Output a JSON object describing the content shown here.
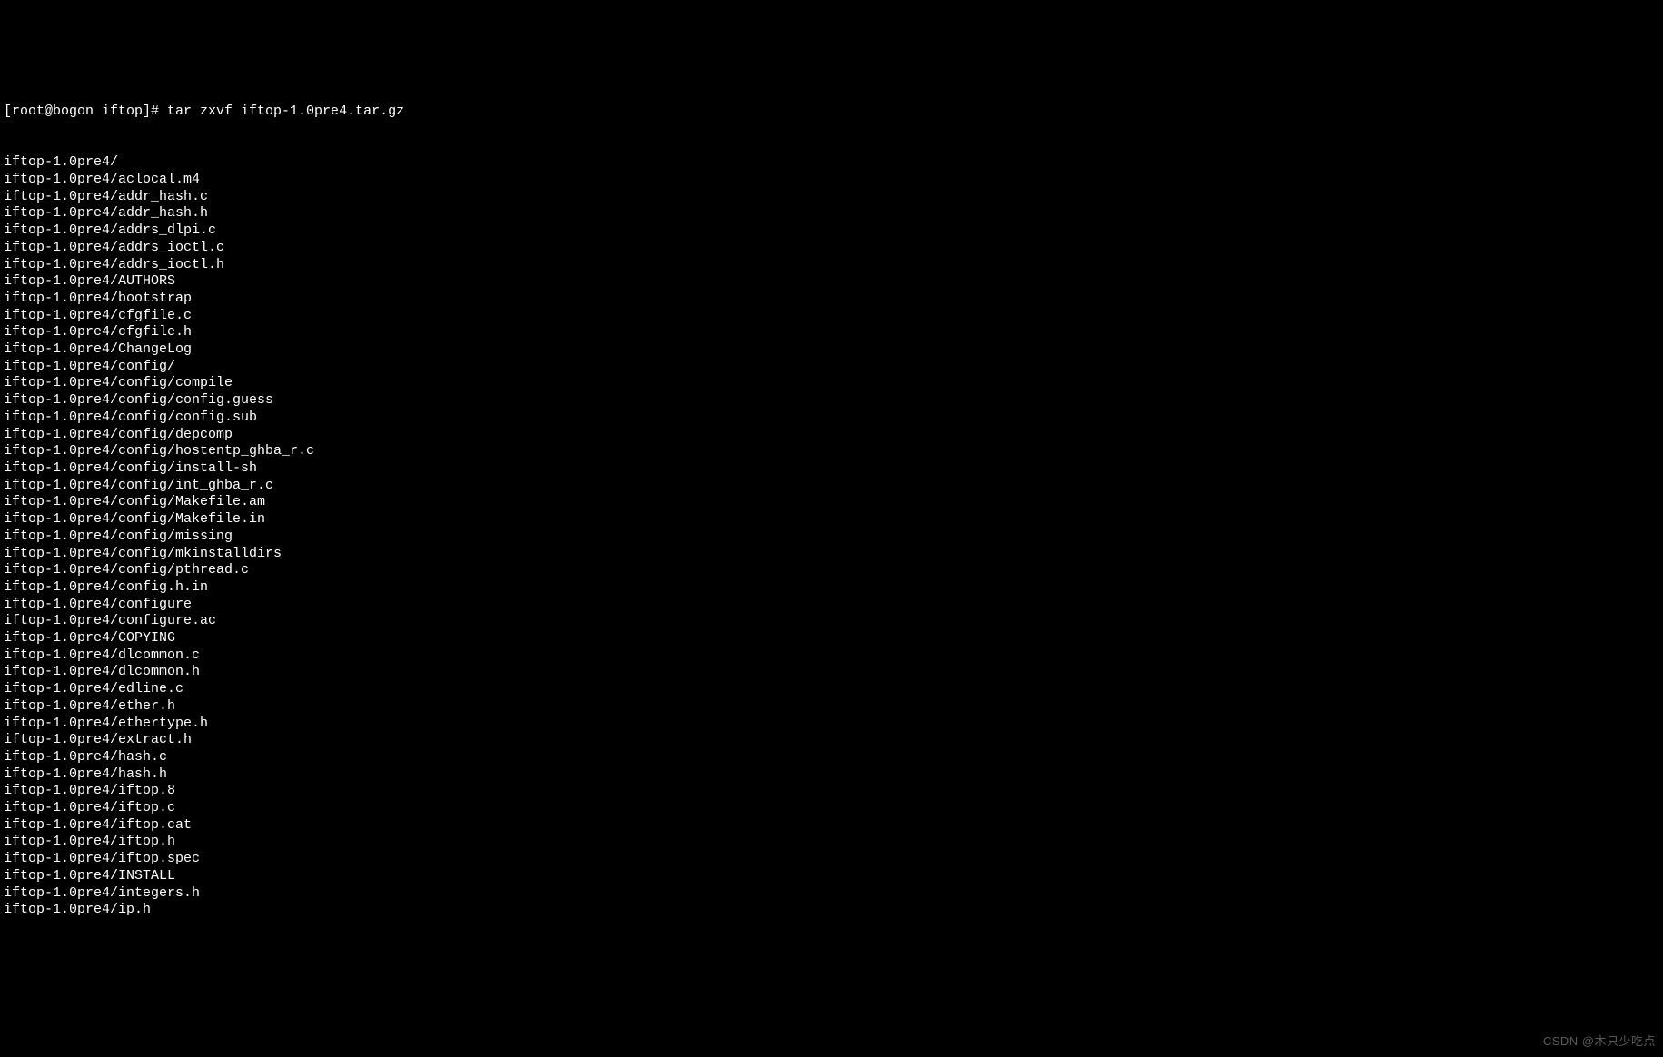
{
  "prompt": {
    "user_host": "[root@bogon iftop]#",
    "command": " tar zxvf iftop-1.0pre4.tar.gz"
  },
  "output_lines": [
    "iftop-1.0pre4/",
    "iftop-1.0pre4/aclocal.m4",
    "iftop-1.0pre4/addr_hash.c",
    "iftop-1.0pre4/addr_hash.h",
    "iftop-1.0pre4/addrs_dlpi.c",
    "iftop-1.0pre4/addrs_ioctl.c",
    "iftop-1.0pre4/addrs_ioctl.h",
    "iftop-1.0pre4/AUTHORS",
    "iftop-1.0pre4/bootstrap",
    "iftop-1.0pre4/cfgfile.c",
    "iftop-1.0pre4/cfgfile.h",
    "iftop-1.0pre4/ChangeLog",
    "iftop-1.0pre4/config/",
    "iftop-1.0pre4/config/compile",
    "iftop-1.0pre4/config/config.guess",
    "iftop-1.0pre4/config/config.sub",
    "iftop-1.0pre4/config/depcomp",
    "iftop-1.0pre4/config/hostentp_ghba_r.c",
    "iftop-1.0pre4/config/install-sh",
    "iftop-1.0pre4/config/int_ghba_r.c",
    "iftop-1.0pre4/config/Makefile.am",
    "iftop-1.0pre4/config/Makefile.in",
    "iftop-1.0pre4/config/missing",
    "iftop-1.0pre4/config/mkinstalldirs",
    "iftop-1.0pre4/config/pthread.c",
    "iftop-1.0pre4/config.h.in",
    "iftop-1.0pre4/configure",
    "iftop-1.0pre4/configure.ac",
    "iftop-1.0pre4/COPYING",
    "iftop-1.0pre4/dlcommon.c",
    "iftop-1.0pre4/dlcommon.h",
    "iftop-1.0pre4/edline.c",
    "iftop-1.0pre4/ether.h",
    "iftop-1.0pre4/ethertype.h",
    "iftop-1.0pre4/extract.h",
    "iftop-1.0pre4/hash.c",
    "iftop-1.0pre4/hash.h",
    "iftop-1.0pre4/iftop.8",
    "iftop-1.0pre4/iftop.c",
    "iftop-1.0pre4/iftop.cat",
    "iftop-1.0pre4/iftop.h",
    "iftop-1.0pre4/iftop.spec",
    "iftop-1.0pre4/INSTALL",
    "iftop-1.0pre4/integers.h",
    "iftop-1.0pre4/ip.h"
  ],
  "watermark": "CSDN @木只少吃点"
}
